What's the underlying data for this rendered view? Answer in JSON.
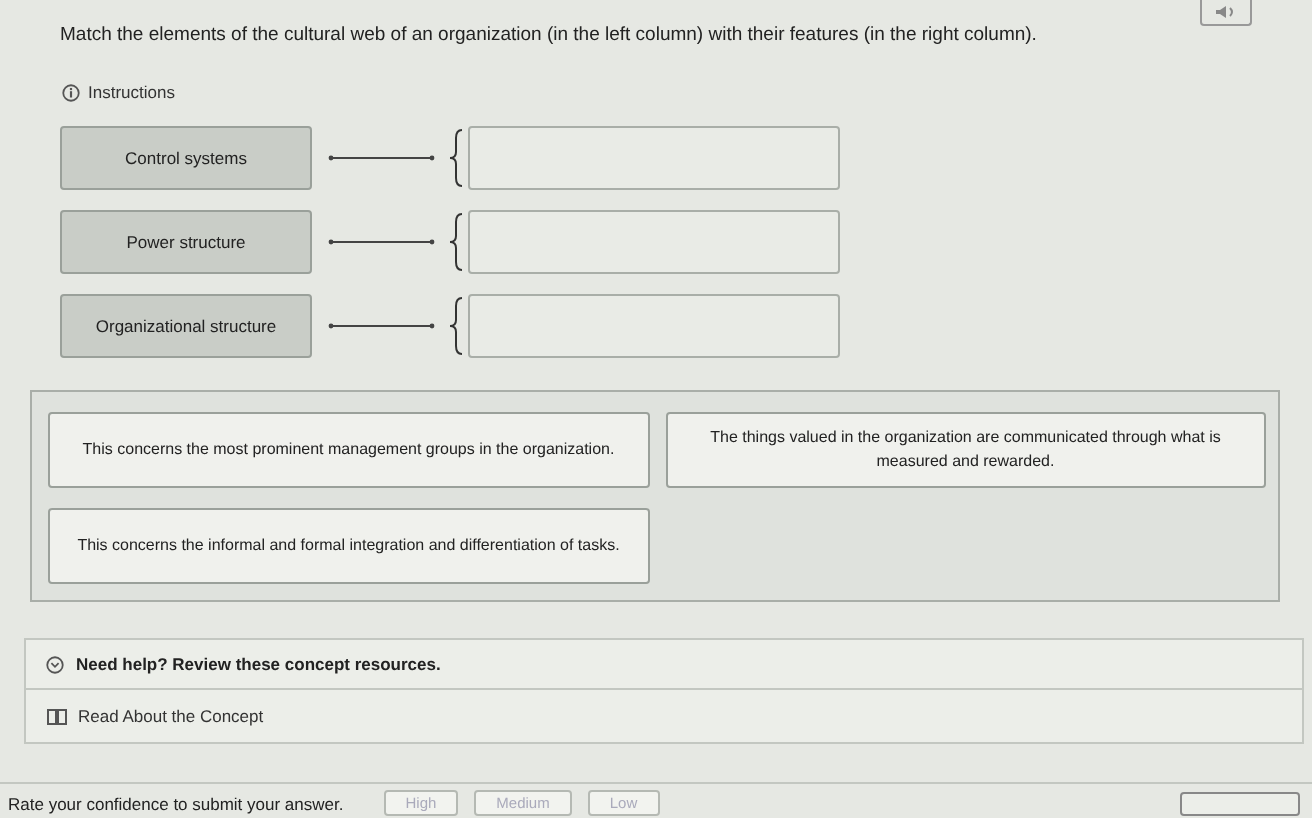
{
  "question": "Match the elements of the cultural web of an organization (in the left column) with their features (in the right column).",
  "instructions_link": "Instructions",
  "terms": [
    "Control systems",
    "Power structure",
    "Organizational structure"
  ],
  "pool": [
    "This concerns the most prominent management groups in the organization.",
    "The things valued in the organization are communicated through what is measured and rewarded.",
    "This concerns the informal and formal integration and differentiation of tasks."
  ],
  "help": {
    "title": "Need help? Review these concept resources.",
    "resources": [
      "Read About the Concept"
    ]
  },
  "confidence": {
    "prompt": "Rate your confidence to submit your answer.",
    "options": [
      {
        "label": "High",
        "disabled": true
      },
      {
        "label": "Medium",
        "disabled": true
      },
      {
        "label": "Low",
        "disabled": true
      }
    ]
  }
}
